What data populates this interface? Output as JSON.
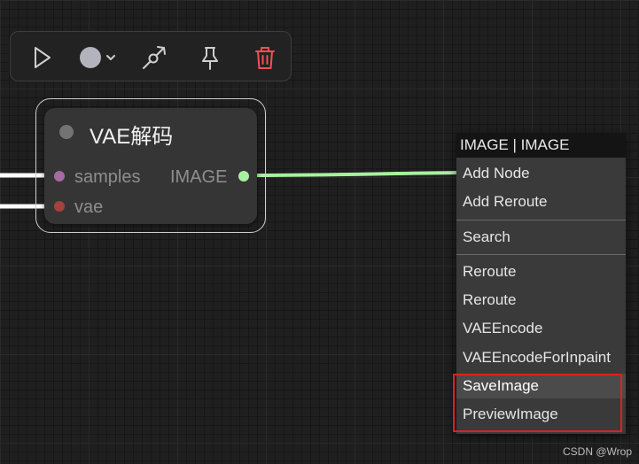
{
  "toolbar": {
    "buttons": [
      {
        "name": "play",
        "icon": "play-icon"
      },
      {
        "name": "color",
        "icon": "color-circle-icon",
        "swatch": "#b3b3bd"
      },
      {
        "name": "link",
        "icon": "link-pen-icon"
      },
      {
        "name": "pin",
        "icon": "pin-icon"
      },
      {
        "name": "delete",
        "icon": "trash-icon",
        "color": "#f05252"
      }
    ]
  },
  "node": {
    "title": "VAE解码",
    "inputs": [
      {
        "label": "samples",
        "color": "#a56aa4"
      },
      {
        "label": "vae",
        "color": "#a3433c"
      }
    ],
    "output": {
      "label": "IMAGE",
      "color": "#a8f0a0"
    }
  },
  "menu": {
    "title": "IMAGE | IMAGE",
    "groups": [
      [
        "Add Node",
        "Add Reroute"
      ],
      [
        "Search"
      ],
      [
        "Reroute",
        "Reroute",
        "VAEEncode",
        "VAEEncodeForInpaint",
        "SaveImage",
        "PreviewImage"
      ]
    ],
    "highlighted": "SaveImage"
  },
  "watermark": "CSDN @Wrop",
  "colors": {
    "link_wire": "#a8f0a0",
    "input_wire": "#ffffff",
    "highlight_box": "#e02020"
  }
}
